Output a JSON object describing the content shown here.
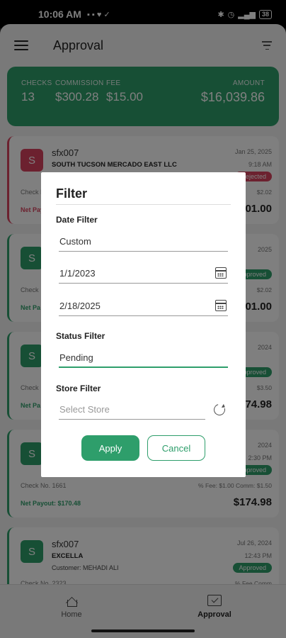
{
  "status_bar": {
    "time": "10:06 AM",
    "battery": "38"
  },
  "header": {
    "title": "Approval"
  },
  "summary": {
    "checks_label": "CHECKS",
    "checks": "13",
    "commission_label": "COMMISSION",
    "commission": "$300.28",
    "fee_label": "FEE",
    "fee": "$15.00",
    "amount_label": "AMOUNT",
    "amount": "$16,039.86"
  },
  "cards": [
    {
      "initial": "S",
      "name": "sfx007",
      "store": "SOUTH TUCSON MERCADO EAST LLC",
      "customer": "",
      "date": "Jan 25, 2025",
      "time": "9:18 AM",
      "status": "Rejected",
      "check": "Check No.",
      "fee": "$2.02",
      "net": "Net Payout:",
      "total": "$101.00"
    },
    {
      "initial": "S",
      "name": "",
      "store": "",
      "customer": "",
      "date": "2025",
      "time": "",
      "status": "Approved",
      "check": "Check",
      "fee": "$2.02",
      "net": "Net Pa",
      "total": "$101.00"
    },
    {
      "initial": "S",
      "name": "",
      "store": "",
      "customer": "",
      "date": "2024",
      "time": "",
      "status": "Approved",
      "check": "Check",
      "fee": "$3.50",
      "net": "Net Pa",
      "total": "$174.98"
    },
    {
      "initial": "S",
      "name": "",
      "store": "",
      "customer": "",
      "date": "2024",
      "time": "2:30 PM",
      "status": "Approved",
      "check": "Check No. 1661",
      "fee": "% Fee: $1.00   Comm: $1.50",
      "net": "Net Payout: $170.48",
      "total": "$174.98"
    },
    {
      "initial": "S",
      "name": "sfx007",
      "store": "EXCELLA",
      "customer": "Customer: MEHADI ALI",
      "date": "Jul 26, 2024",
      "time": "12:43 PM",
      "status": "Approved",
      "check": "Check No. 2323",
      "fee": "% Fee     Comm",
      "net": "",
      "total": ""
    }
  ],
  "nav": {
    "home": "Home",
    "approval": "Approval"
  },
  "dialog": {
    "title": "Filter",
    "date_filter_label": "Date Filter",
    "date_filter_value": "Custom",
    "start_date": "1/1/2023",
    "end_date": "2/18/2025",
    "status_filter_label": "Status Filter",
    "status_filter_value": "Pending",
    "store_filter_label": "Store Filter",
    "store_placeholder": "Select Store",
    "apply_label": "Apply",
    "cancel_label": "Cancel"
  },
  "colors": {
    "brand": "#2e9e6b",
    "rejected": "#d9435e"
  }
}
